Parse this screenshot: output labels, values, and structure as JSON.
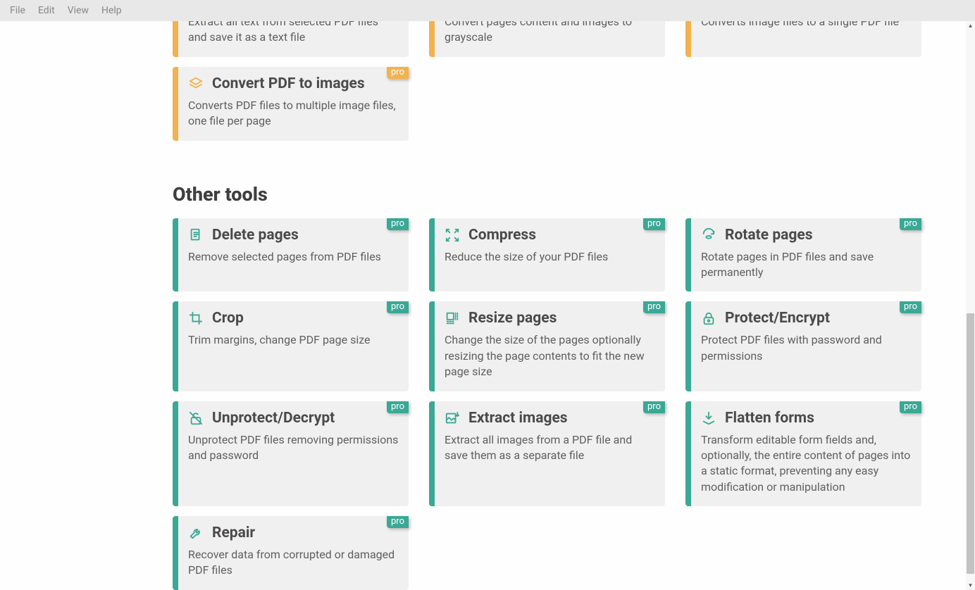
{
  "menubar": [
    "File",
    "Edit",
    "View",
    "Help"
  ],
  "badges": {
    "pro": "pro"
  },
  "partial_row": [
    {
      "desc": "Extract all text from selected PDF files and save it as a text file",
      "accent": "orange"
    },
    {
      "desc": "Convert pages content and images to grayscale",
      "accent": "orange"
    },
    {
      "desc": "Converts image files to a single PDF file",
      "accent": "orange"
    }
  ],
  "convert_extra": {
    "title": "Convert PDF to images",
    "desc": "Converts PDF files to multiple image files, one file per page",
    "accent": "orange",
    "icon": "layers-icon",
    "pro": true
  },
  "section2_title": "Other tools",
  "other_tools": [
    {
      "title": "Delete pages",
      "desc": "Remove selected pages from PDF files",
      "icon": "delete-page-icon",
      "pro": true
    },
    {
      "title": "Compress",
      "desc": "Reduce the size of your PDF files",
      "icon": "compress-icon",
      "pro": true
    },
    {
      "title": "Rotate pages",
      "desc": "Rotate pages in PDF files and save permanently",
      "icon": "rotate-icon",
      "pro": true
    },
    {
      "title": "Crop",
      "desc": "Trim margins, change PDF page size",
      "icon": "crop-icon",
      "pro": true
    },
    {
      "title": "Resize pages",
      "desc": "Change the size of the pages optionally resizing the page contents to fit the new page size",
      "icon": "resize-icon",
      "pro": true
    },
    {
      "title": "Protect/Encrypt",
      "desc": "Protect PDF files with password and permissions",
      "icon": "lock-icon",
      "pro": true
    },
    {
      "title": "Unprotect/Decrypt",
      "desc": "Unprotect PDF files removing permissions and password",
      "icon": "unlock-icon",
      "pro": true
    },
    {
      "title": "Extract images",
      "desc": "Extract all images from a PDF file and save them as a separate file",
      "icon": "image-down-icon",
      "pro": true
    },
    {
      "title": "Flatten forms",
      "desc": "Transform editable form fields and, optionally, the entire content of pages into a static format, preventing any easy modification or manipulation",
      "icon": "flatten-icon",
      "pro": true
    },
    {
      "title": "Repair",
      "desc": "Recover data from corrupted or damaged PDF files",
      "icon": "wrench-icon",
      "pro": true
    }
  ]
}
